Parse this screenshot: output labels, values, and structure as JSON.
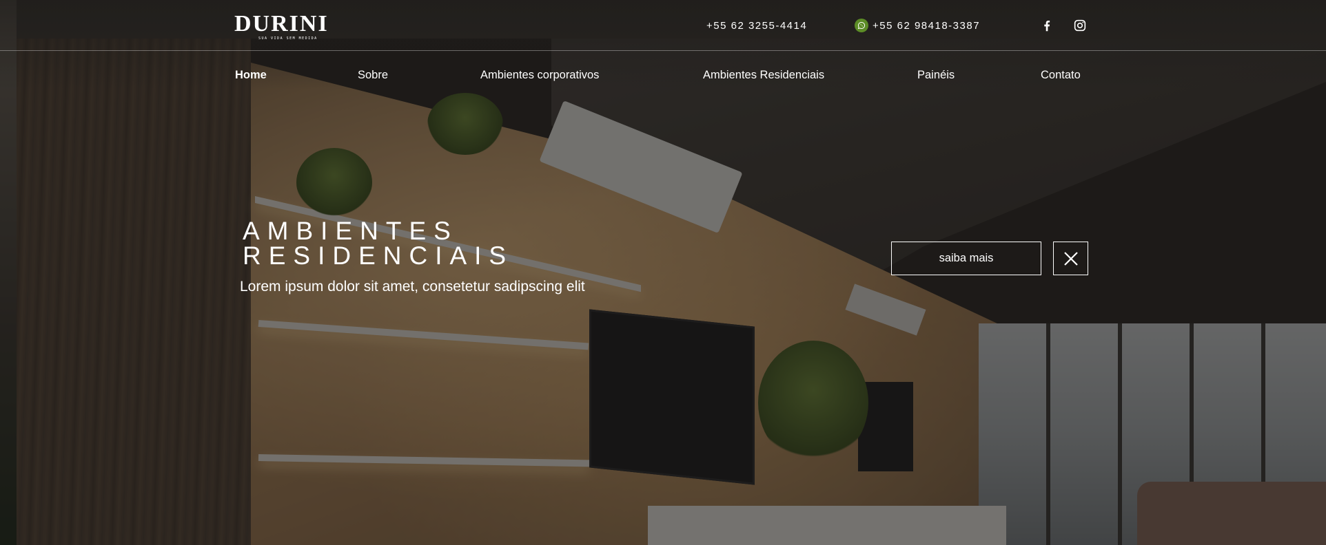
{
  "brand": {
    "name": "DURINI",
    "tagline": "SUA VIDA SEM MEDIDA"
  },
  "contact": {
    "phone": "+55 62 3255-4414",
    "whatsapp": "+55 62 98418-3387"
  },
  "social": {
    "icons": [
      "facebook-icon",
      "instagram-icon"
    ]
  },
  "nav": {
    "items": [
      {
        "label": "Home",
        "active": true
      },
      {
        "label": "Sobre"
      },
      {
        "label": "Ambientes corporativos"
      },
      {
        "label": "Ambientes Residenciais"
      },
      {
        "label": "Painéis"
      },
      {
        "label": "Contato"
      }
    ]
  },
  "hero": {
    "title_line1": "AMBIENTES",
    "title_line2": "RESIDENCIAIS",
    "subtitle": "Lorem ipsum dolor sit amet, consetetur sadipscing elit",
    "cta_label": "saiba mais"
  },
  "colors": {
    "whatsapp_green": "#5c8c26",
    "text": "#ffffff"
  }
}
